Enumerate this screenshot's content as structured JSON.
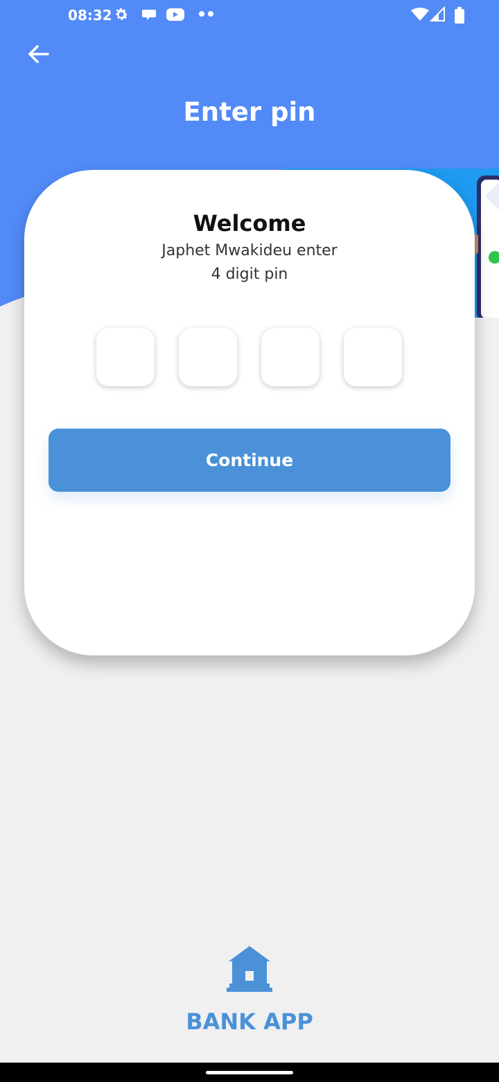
{
  "status_bar": {
    "time": "08:32",
    "icons_left": [
      "gear-icon",
      "chat-icon",
      "youtube-icon",
      "more-dots-icon"
    ],
    "icons_right": [
      "wifi-icon",
      "cell-signal-icon",
      "battery-icon"
    ]
  },
  "header": {
    "title": "Enter pin",
    "back_icon": "arrow-left-icon",
    "background_color": "#528bf7"
  },
  "card": {
    "welcome": "Welcome",
    "subtitle_line1": "Japhet Mwakideu enter",
    "subtitle_line2": "4 digit pin",
    "pin_boxes": [
      "",
      "",
      "",
      ""
    ],
    "continue_label": "Continue",
    "accent_color": "#4a91d8"
  },
  "footer": {
    "logo_icon": "bank-icon",
    "app_name": "BANK APP"
  }
}
